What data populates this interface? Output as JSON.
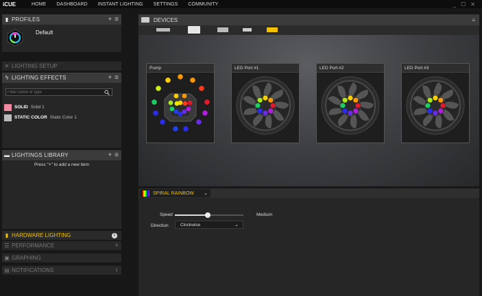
{
  "app": {
    "brand": "iCUE"
  },
  "nav": [
    "HOME",
    "DASHBOARD",
    "INSTANT LIGHTING",
    "SETTINGS",
    "COMMUNITY"
  ],
  "window_controls": [
    "_",
    "☐",
    "✕"
  ],
  "profiles": {
    "title": "PROFILES",
    "add": "+",
    "menu": "≡",
    "default_name": "Default"
  },
  "lighting_setup": {
    "title": "LIGHTING SETUP"
  },
  "lighting_effects": {
    "title": "LIGHTING EFFECTS",
    "add": "+",
    "menu": "≡",
    "filter_placeholder": "Filter name or type",
    "items": [
      {
        "type": "SOLID",
        "name": "Solid 1",
        "color": "#f28aa0"
      },
      {
        "type": "STATIC COLOR",
        "name": "Static Color 1",
        "color": "#bbbbbb"
      }
    ]
  },
  "library": {
    "title": "LIGHTINGS LIBRARY",
    "add": "+",
    "menu": "≡",
    "hint": "Press \"+\" to add a new item"
  },
  "sections": [
    {
      "title": "HARDWARE LIGHTING",
      "count": "",
      "active": true
    },
    {
      "title": "PERFORMANCE",
      "count": "4"
    },
    {
      "title": "GRAPHING",
      "count": ""
    },
    {
      "title": "NOTIFICATIONS",
      "count": "1"
    }
  ],
  "devices": {
    "title": "DEVICES",
    "menu": "≡"
  },
  "device_cards": [
    {
      "label": "Pump",
      "kind": "pump"
    },
    {
      "label": "LED Port #1",
      "kind": "fan"
    },
    {
      "label": "LED Port #2",
      "kind": "fan"
    },
    {
      "label": "LED Port #3",
      "kind": "fan"
    }
  ],
  "effect": {
    "name": "SPIRAL RAINBOW",
    "speed_label": "Speed",
    "speed_value": "Medium",
    "speed_fraction": 0.48,
    "direction_label": "Direction",
    "direction_value": "Clockwise"
  },
  "colors": {
    "accent": "#f2c200",
    "panel": "#262626",
    "header": "#3b3b3b"
  }
}
